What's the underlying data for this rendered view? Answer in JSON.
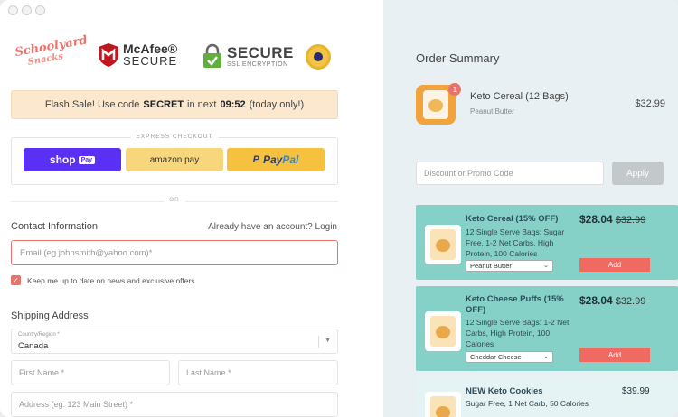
{
  "logos": {
    "schoolyard_l1": "Schoolyard",
    "schoolyard_l2": "Snacks",
    "mcafee_l1": "McAfee®",
    "mcafee_l2": "SECURE",
    "secure_l1": "SECURE",
    "secure_l2": "SSL ENCRYPTION"
  },
  "flash": {
    "prefix": "Flash Sale! Use code",
    "code": "SECRET",
    "middle": "in next",
    "timer": "09:52",
    "suffix": "(today only!)"
  },
  "express": {
    "label": "EXPRESS CHECKOUT",
    "shop_pay": "shop",
    "shop_pay_tag": "Pay",
    "amazon_pay": "amazon pay",
    "paypal_1": "Pay",
    "paypal_2": "Pal",
    "or": "OR"
  },
  "contact": {
    "title": "Contact Information",
    "login_text": "Already have an account? Login",
    "email_placeholder": "Email (eg.johnsmith@yahoo.com)*",
    "newsletter_label": "Keep me up to date on news and exclusive offers"
  },
  "shipping": {
    "title": "Shipping Address",
    "country_label": "Country/Region *",
    "country_value": "Canada",
    "first_name": "First Name *",
    "last_name": "Last Name *",
    "address": "Address (eg. 123 Main Street) *"
  },
  "order_summary": {
    "title": "Order Summary",
    "item": {
      "quantity": "1",
      "name": "Keto Cereal (12 Bags)",
      "variant": "Peanut Butter",
      "price": "$32.99"
    },
    "discount_placeholder": "Discount or Promo Code",
    "apply_label": "Apply"
  },
  "upsells": [
    {
      "name": "Keto Cereal (15% OFF)",
      "desc": "12 Single Serve Bags: Sugar Free, 1-2 Net Carbs, High Protein, 100 Calories",
      "price": "$28.04",
      "old_price": "$32.99",
      "option": "Peanut Butter",
      "add_label": "Add"
    },
    {
      "name": "Keto Cheese Puffs (15% OFF)",
      "desc": "12 Single Serve Bags: 1-2 Net Carbs, High Protein, 100 Calories",
      "price": "$28.04",
      "old_price": "$32.99",
      "option": "Cheddar Cheese",
      "add_label": "Add"
    },
    {
      "name": "NEW Keto Cookies",
      "desc": "Sugar Free, 1 Net Carb, 50 Calories",
      "price": "$39.99"
    }
  ],
  "colors": {
    "accent": "#e8736c",
    "upsell_bg": "#86d1c7",
    "right_bg": "#e8f0f3",
    "shop_pay": "#5a31f4",
    "paypal": "#f7c140"
  }
}
